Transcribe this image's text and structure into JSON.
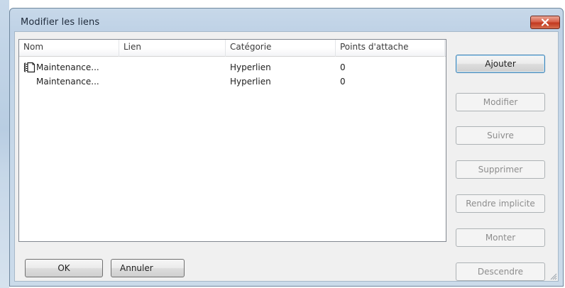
{
  "dialog": {
    "title": "Modifier les liens"
  },
  "table": {
    "columns": [
      "Nom",
      "Lien",
      "Catégorie",
      "Points d'attache"
    ],
    "rows": [
      {
        "nom": "Maintenance...",
        "lien": "",
        "categorie": "Hyperlien",
        "points": "0",
        "icon": "document-link-icon"
      },
      {
        "nom": "Maintenance...",
        "lien": "",
        "categorie": "Hyperlien",
        "points": "0",
        "icon": ""
      }
    ]
  },
  "side_buttons": {
    "ajouter": "Ajouter",
    "modifier": "Modifier",
    "suivre": "Suivre",
    "supprimer": "Supprimer",
    "rendre_implicite": "Rendre implicite",
    "monter": "Monter",
    "descendre": "Descendre"
  },
  "footer_buttons": {
    "ok": "OK",
    "annuler": "Annuler"
  },
  "icons": {
    "close": "close-icon",
    "grip": "resize-grip-icon"
  },
  "colors": {
    "close_button": "#c7432a",
    "title_bar": "#c4d6e8",
    "default_button_border": "#3c7fb1"
  }
}
